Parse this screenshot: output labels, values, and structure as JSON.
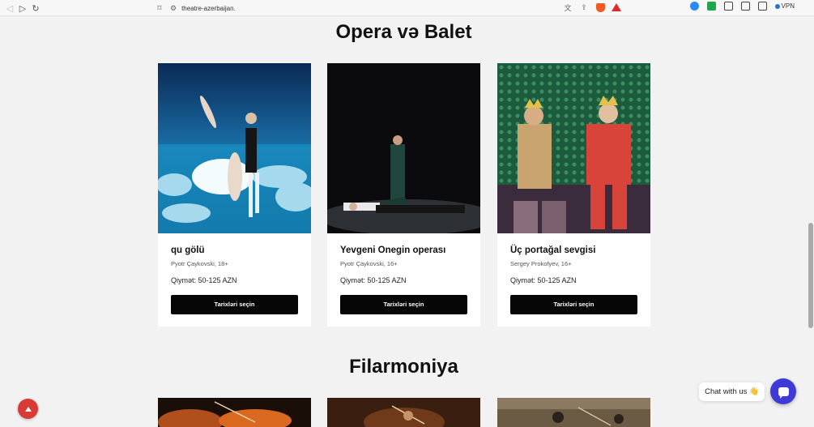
{
  "browser": {
    "url": "theatre-azerbaijan.",
    "vpn_label": "VPN"
  },
  "sections": [
    {
      "title": "Opera və Balet"
    },
    {
      "title": "Filarmoniya"
    }
  ],
  "cards": [
    {
      "name": "qu gölü",
      "author": "Pyotr Çaykovski, 18+",
      "price": "Qiymət: 50-125 AZN",
      "button": "Tarixləri seçin"
    },
    {
      "name": "Yevgeni Onegin operası",
      "author": "Pyotr Çaykovski, 16+",
      "price": "Qiymət: 50-125 AZN",
      "button": "Tarixləri seçin"
    },
    {
      "name": "Üç portağal sevgisi",
      "author": "Sergey Prokofyev, 16+",
      "price": "Qiymət: 50-125 AZN",
      "button": "Tarixləri seçin"
    }
  ],
  "chat": {
    "label": "Chat with us 👋"
  },
  "icons": {
    "back": "back-arrow-icon",
    "forward": "forward-arrow-icon",
    "reload": "reload-icon",
    "bookmark": "bookmark-icon",
    "site_settings": "tune-icon",
    "translate": "translate-icon",
    "share": "share-icon",
    "brave": "brave-shield-icon",
    "rewards": "warning-triangle-icon",
    "scroll_top": "arrow-up-icon",
    "chat": "chat-bubble-icon"
  },
  "colors": {
    "accent_chat": "#3d3ad6",
    "scroll_top": "#d83a35",
    "button_bg": "#050505"
  }
}
